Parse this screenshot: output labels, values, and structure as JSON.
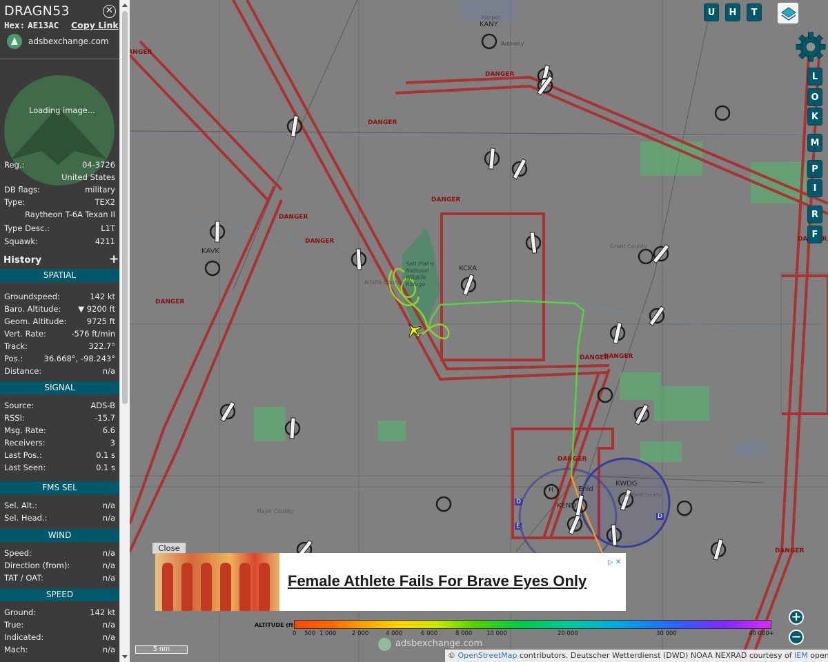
{
  "aircraft": {
    "callsign": "DRAGN53",
    "hex_label": "Hex:",
    "hex": "AE13AC",
    "copy_link": "Copy Link",
    "source_site": "adsbexchange.com",
    "photo_status": "Loading image..."
  },
  "details": [
    {
      "label": "Reg.:",
      "value": "04-3726"
    },
    {
      "label": "",
      "value": "United States"
    },
    {
      "label": "DB flags:",
      "value": "military"
    },
    {
      "label": "Type:",
      "value": "TEX2"
    },
    {
      "label": "",
      "value": "Raytheon T-6A Texan II"
    },
    {
      "label": "Type Desc.:",
      "value": "L1T"
    },
    {
      "label": "Squawk:",
      "value": "4211"
    }
  ],
  "history_label": "History",
  "history_plus": "+",
  "sections": {
    "spatial": {
      "title": "SPATIAL",
      "rows": [
        {
          "label": "Groundspeed:",
          "value": "142 kt"
        },
        {
          "label": "Baro. Altitude:",
          "value": "▼ 9200 ft"
        },
        {
          "label": "Geom. Altitude:",
          "value": "9725 ft"
        },
        {
          "label": "Vert. Rate:",
          "value": "-576 ft/min"
        },
        {
          "label": "Track:",
          "value": "322.7°"
        },
        {
          "label": "Pos.:",
          "value": "36.668°, -98.243°"
        },
        {
          "label": "Distance:",
          "value": "n/a"
        }
      ]
    },
    "signal": {
      "title": "SIGNAL",
      "rows": [
        {
          "label": "Source:",
          "value": "ADS-B"
        },
        {
          "label": "RSSI:",
          "value": "-15.7"
        },
        {
          "label": "Msg. Rate:",
          "value": "6.6"
        },
        {
          "label": "Receivers:",
          "value": "3"
        },
        {
          "label": "Last Pos.:",
          "value": "0.1 s"
        },
        {
          "label": "Last Seen:",
          "value": "0.1 s"
        }
      ]
    },
    "fms": {
      "title": "FMS SEL",
      "rows": [
        {
          "label": "Sel. Alt.:",
          "value": "n/a"
        },
        {
          "label": "Sel. Head.:",
          "value": "n/a"
        }
      ]
    },
    "wind": {
      "title": "WIND",
      "rows": [
        {
          "label": "Speed:",
          "value": "n/a"
        },
        {
          "label": "Direction (from):",
          "value": "n/a"
        },
        {
          "label": "TAT / OAT:",
          "value": "n/a"
        }
      ]
    },
    "speed": {
      "title": "SPEED",
      "rows": [
        {
          "label": "Ground:",
          "value": "142 kt"
        },
        {
          "label": "True:",
          "value": "n/a"
        },
        {
          "label": "Indicated:",
          "value": "n/a"
        },
        {
          "label": "Mach:",
          "value": "n/a"
        }
      ]
    }
  },
  "map": {
    "top_buttons": [
      "U",
      "H",
      "T"
    ],
    "side_buttons": [
      "L",
      "O",
      "K",
      "M",
      "P",
      "I",
      "R",
      "F"
    ],
    "airports": [
      "KANY",
      "KAVK",
      "KCKA",
      "KEND",
      "KWDG"
    ],
    "place_labels": [
      "Harper",
      "Anthony",
      "Salt Plains National Wildlife Refuge",
      "Alfalfa County",
      "Grant County",
      "Major County",
      "Enid",
      "Garfield County"
    ],
    "danger_label": "DANGER",
    "airspace_letters": [
      "D",
      "E",
      "D"
    ],
    "heliport": "H",
    "scale": "5 nm",
    "watermark": "adsbexchange.com",
    "zoom_in": "+",
    "zoom_out": "−"
  },
  "ad": {
    "close": "Close",
    "headline": "Female Athlete Fails For Brave Eyes Only",
    "badge": "▷ ✕"
  },
  "altitude_legend": {
    "title": "ALTITUDE (ft)",
    "ticks": [
      "0",
      "500",
      "1 000",
      "2 000",
      "4 000",
      "6 000",
      "8 000",
      "10 000",
      "20 000",
      "30 000",
      "40 000+"
    ]
  },
  "attribution": {
    "prefix": "©",
    "osm": "OpenStreetMap",
    "middle": "contributors. Deutscher Wetterdienst (DWD) NOAA NEXRAD courtesy of",
    "iem": "IEM",
    "suffix": "openAIP.net"
  },
  "colors": {
    "accent": "#00596b",
    "danger": "#b02a2a",
    "track_green": "#66dd44",
    "track_orange": "#f0a020",
    "class_d": "#3a3a9a"
  }
}
